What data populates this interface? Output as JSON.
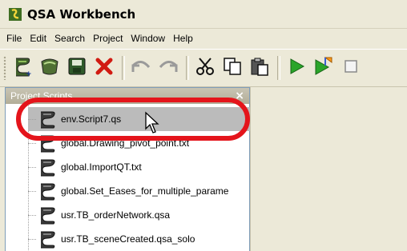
{
  "window": {
    "title": "QSA Workbench"
  },
  "menubar": {
    "items": [
      {
        "label": "File"
      },
      {
        "label": "Edit"
      },
      {
        "label": "Search"
      },
      {
        "label": "Project"
      },
      {
        "label": "Window"
      },
      {
        "label": "Help"
      }
    ]
  },
  "toolbar": {
    "buttons": [
      {
        "icon": "new-script-icon"
      },
      {
        "icon": "open-icon"
      },
      {
        "icon": "save-icon"
      },
      {
        "icon": "delete-icon"
      },
      {
        "icon": "undo-icon"
      },
      {
        "icon": "redo-icon"
      },
      {
        "icon": "cut-icon"
      },
      {
        "icon": "copy-icon"
      },
      {
        "icon": "paste-icon"
      },
      {
        "icon": "run-icon"
      },
      {
        "icon": "run-to-icon"
      },
      {
        "icon": "stop-icon"
      }
    ]
  },
  "dock": {
    "title": "Project Scripts",
    "close_glyph": "×"
  },
  "scripts": [
    {
      "label": "env.Script7.qs",
      "selected": true
    },
    {
      "label": "global.Drawing_pivot_point.txt"
    },
    {
      "label": "global.ImportQT.txt"
    },
    {
      "label": "global.Set_Eases_for_multiple_parame"
    },
    {
      "label": "usr.TB_orderNetwork.qsa"
    },
    {
      "label": "usr.TB_sceneCreated.qsa_solo"
    }
  ],
  "colors": {
    "highlight_ring": "#e4141b",
    "selection": "#bbbbbb",
    "chrome": "#ece9d8"
  }
}
